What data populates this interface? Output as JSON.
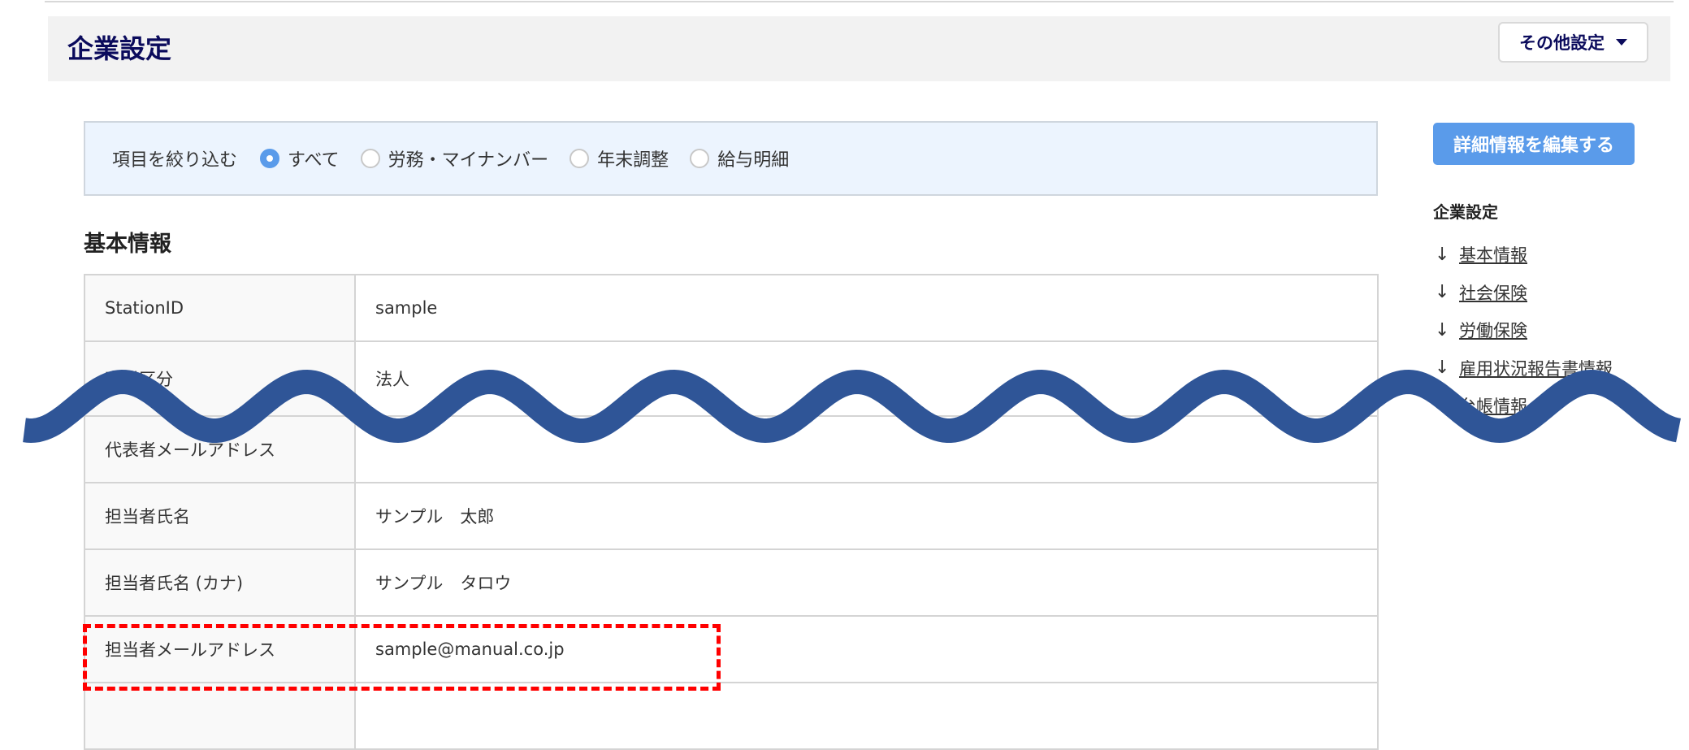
{
  "header": {
    "title": "企業設定",
    "other_settings": "その他設定"
  },
  "filter": {
    "label": "項目を絞り込む",
    "options": [
      {
        "label": "すべて",
        "selected": true
      },
      {
        "label": "労務・マイナンバー",
        "selected": false
      },
      {
        "label": "年末調整",
        "selected": false
      },
      {
        "label": "給与明細",
        "selected": false
      }
    ]
  },
  "section_title": "基本情報",
  "table": [
    {
      "key": "StationID",
      "value": "sample"
    },
    {
      "key": "事業区分",
      "value": "法人"
    },
    {
      "key": "代表者メールアドレス",
      "value": ""
    },
    {
      "key": "担当者氏名",
      "value": "サンプル　太郎"
    },
    {
      "key": "担当者氏名 (カナ)",
      "value": "サンプル　タロウ"
    },
    {
      "key": "担当者メールアドレス",
      "value": "sample@manual.co.jp"
    },
    {
      "key": "",
      "value": ""
    }
  ],
  "sidebar": {
    "edit_button": "詳細情報を編集する",
    "title": "企業設定",
    "links": [
      "基本情報",
      "社会保険",
      "労働保険",
      "雇用状況報告書情報",
      "台帳情報"
    ]
  },
  "colors": {
    "accent": "#5a9bea",
    "title": "#0b0b5c",
    "wave": "#2f5597",
    "highlight": "#ff0000"
  }
}
